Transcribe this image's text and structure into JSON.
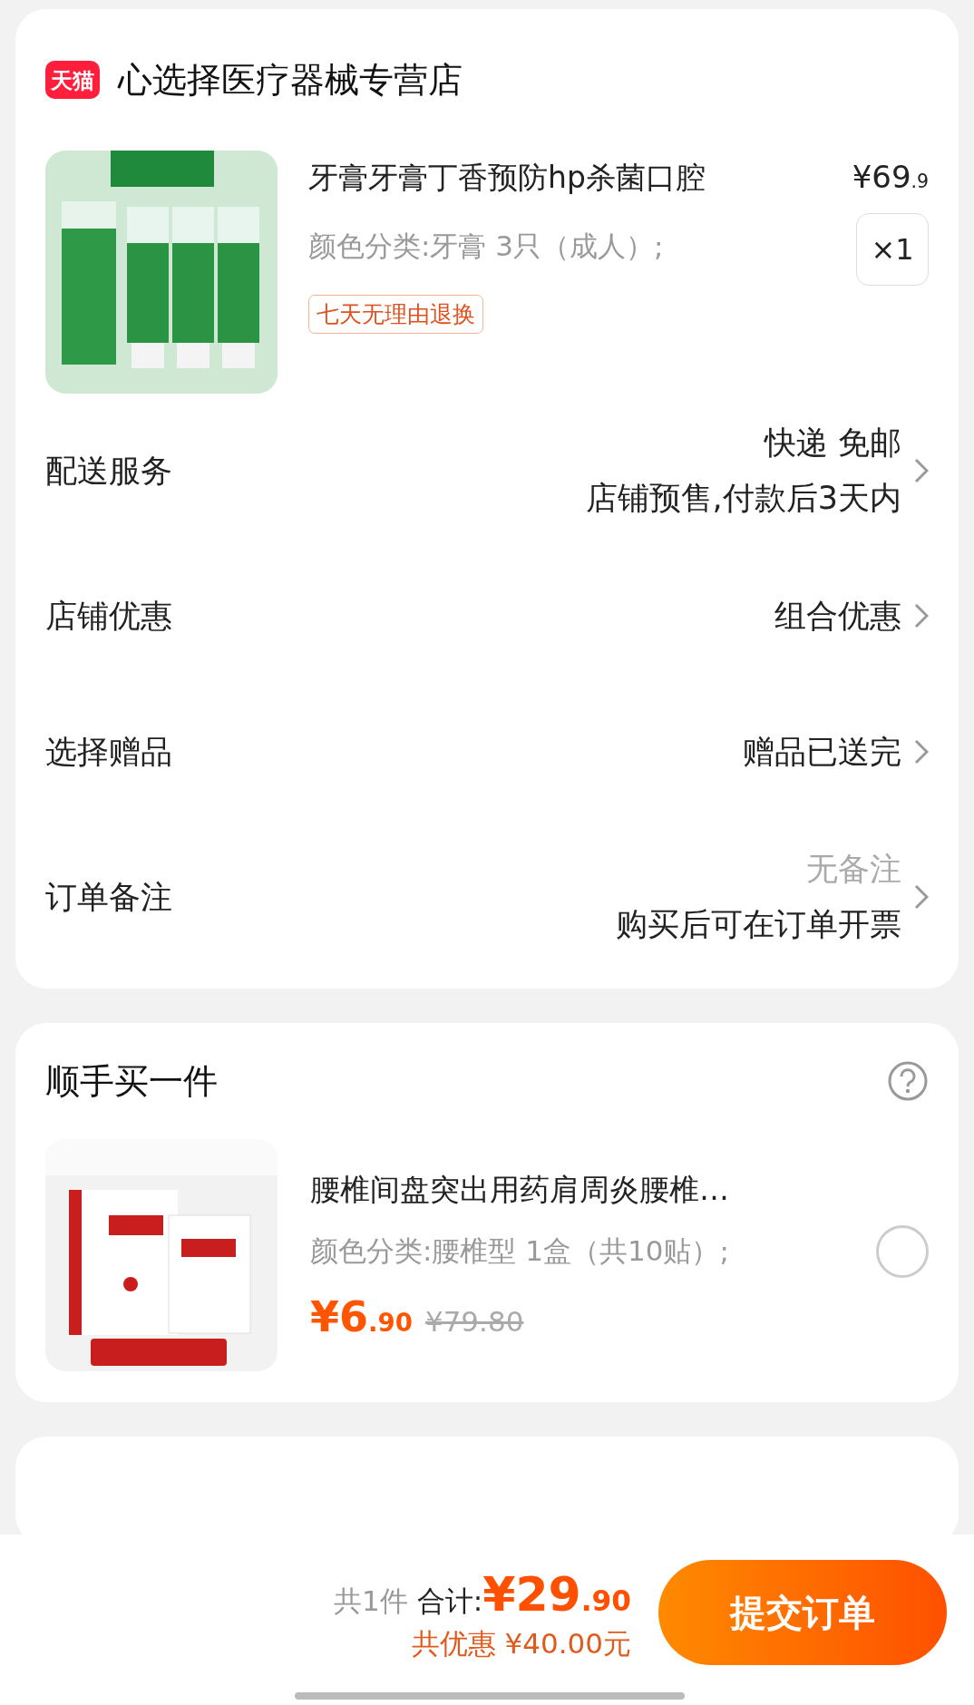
{
  "store": {
    "badge": "天猫",
    "name": "心选择医疗器械专营店"
  },
  "product": {
    "kind": "picture",
    "title": "牙膏牙膏丁香预防hp杀菌口腔",
    "spec": "颜色分类:牙膏 3只（成人）;",
    "tag": "七天无理由退换",
    "price": {
      "currency": "¥",
      "integer": "69",
      "decimal": ".9"
    },
    "quantity": "×1"
  },
  "rows": [
    {
      "label": "配送服务",
      "lines": [
        {
          "text": "快递 免邮",
          "muted": false
        },
        {
          "text": "店铺预售,付款后3天内",
          "muted": false
        }
      ]
    },
    {
      "label": "店铺优惠",
      "lines": [
        {
          "text": "组合优惠",
          "muted": false
        }
      ]
    },
    {
      "label": "选择赠品",
      "lines": [
        {
          "text": "赠品已送完",
          "muted": false
        }
      ]
    },
    {
      "label": "订单备注",
      "lines": [
        {
          "text": "无备注",
          "muted": true
        },
        {
          "text": "购买后可在订单开票",
          "muted": false
        }
      ]
    }
  ],
  "addon": {
    "title": "顺手买一件",
    "items": [
      {
        "kind": "picture",
        "title": "腰椎间盘突出用药肩周炎腰椎…",
        "spec": "颜色分类:腰椎型 1盒（共10贴）;",
        "price": {
          "currency": "¥",
          "integer": "6",
          "decimal": ".90"
        },
        "original_price": "¥79.80",
        "selected": false
      }
    ]
  },
  "footer": {
    "count": "共1件",
    "total_label": "合计:",
    "total": {
      "currency": "¥",
      "integer": "29",
      "decimal": ".90"
    },
    "discount": "共优惠 ¥40.00元",
    "submit": "提交订单"
  }
}
